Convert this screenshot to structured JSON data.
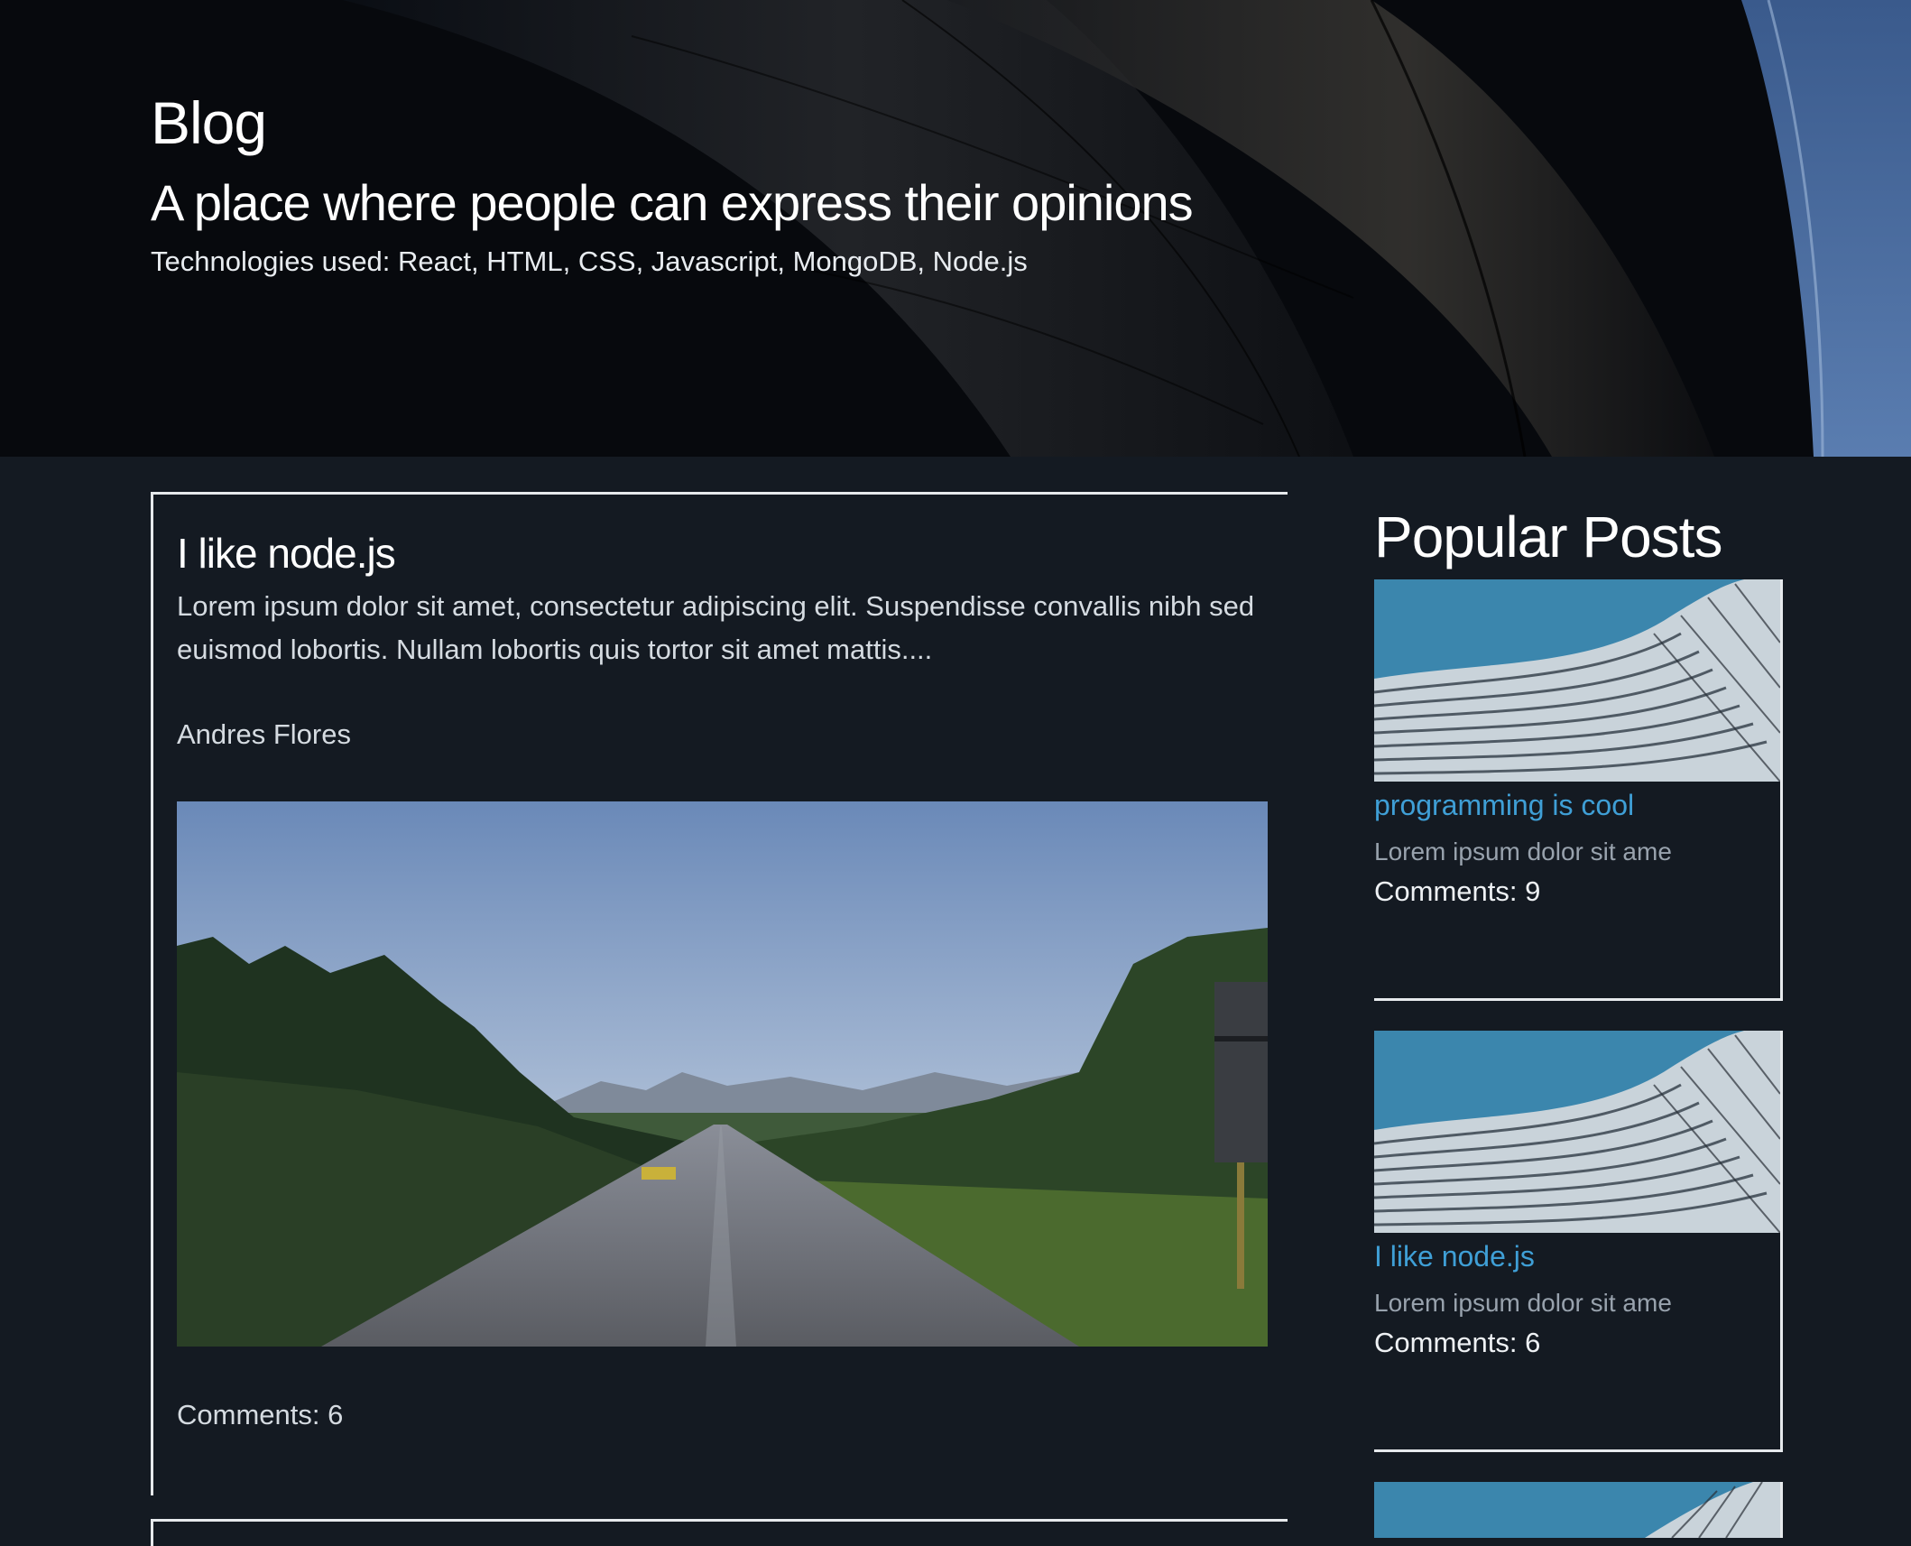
{
  "hero": {
    "title": "Blog",
    "subtitle": "A place where people can express their opinions",
    "technologies": "Technologies used: React, HTML, CSS, Javascript, MongoDB, Node.js"
  },
  "main_post": {
    "title": "I like node.js",
    "excerpt": "Lorem ipsum dolor sit amet, consectetur adipiscing elit. Suspendisse convallis nibh sed euismod lobortis. Nullam lobortis quis tortor sit amet mattis....",
    "author": "Andres Flores",
    "comments": "Comments: 6"
  },
  "sidebar": {
    "title": "Popular Posts",
    "posts": [
      {
        "title": "programming is cool",
        "excerpt": "Lorem ipsum dolor sit ame",
        "comments": "Comments: 9"
      },
      {
        "title": "I like node.js",
        "excerpt": "Lorem ipsum dolor sit ame",
        "comments": "Comments: 6"
      }
    ]
  },
  "colors": {
    "background": "#141a22",
    "link": "#3f9fd6",
    "border": "#e6e9ec"
  }
}
